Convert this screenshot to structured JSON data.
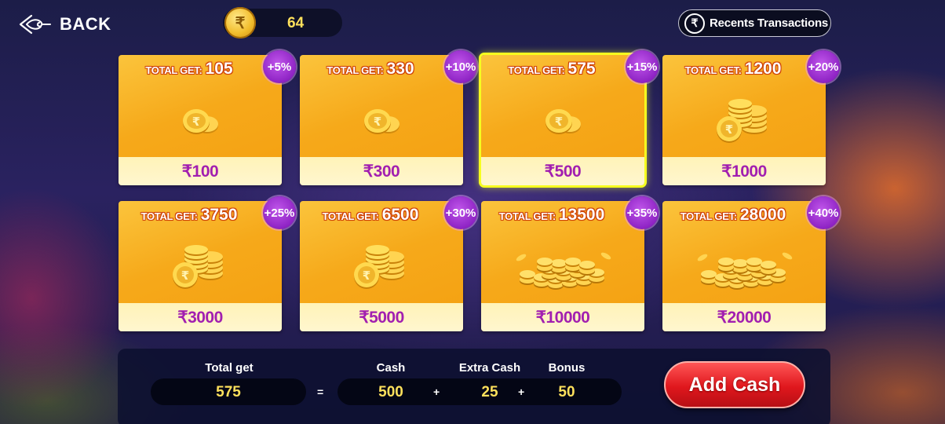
{
  "header": {
    "back_label": "BACK",
    "balance_currency_symbol": "₹",
    "balance_amount": "64",
    "recents_icon_symbol": "₹",
    "recents_label": "Recents Transactions"
  },
  "packages": [
    {
      "total_label": "TOTAL GET:",
      "total_value": "105",
      "bonus": "+5%",
      "price": "₹100",
      "coins_icon": "coin-single-icon"
    },
    {
      "total_label": "TOTAL GET:",
      "total_value": "330",
      "bonus": "+10%",
      "price": "₹300",
      "coins_icon": "coin-single-icon"
    },
    {
      "total_label": "TOTAL GET:",
      "total_value": "575",
      "bonus": "+15%",
      "price": "₹500",
      "coins_icon": "coin-single-icon",
      "selected": true
    },
    {
      "total_label": "TOTAL GET:",
      "total_value": "1200",
      "bonus": "+20%",
      "price": "₹1000",
      "coins_icon": "coin-stack-icon"
    },
    {
      "total_label": "TOTAL GET:",
      "total_value": "3750",
      "bonus": "+25%",
      "price": "₹3000",
      "coins_icon": "coin-stack-icon"
    },
    {
      "total_label": "TOTAL GET:",
      "total_value": "6500",
      "bonus": "+30%",
      "price": "₹5000",
      "coins_icon": "coin-stack-icon"
    },
    {
      "total_label": "TOTAL GET:",
      "total_value": "13500",
      "bonus": "+35%",
      "price": "₹10000",
      "coins_icon": "coin-pile-icon"
    },
    {
      "total_label": "TOTAL GET:",
      "total_value": "28000",
      "bonus": "+40%",
      "price": "₹20000",
      "coins_icon": "coin-pile-icon"
    }
  ],
  "summary": {
    "total_get_label": "Total get",
    "total_get_value": "575",
    "equals": "=",
    "cash_label": "Cash",
    "cash_value": "500",
    "plus1": "+",
    "extra_cash_label": "Extra Cash",
    "extra_cash_value": "25",
    "plus2": "+",
    "bonus_label": "Bonus",
    "bonus_value": "50"
  },
  "add_cash_label": "Add Cash",
  "colors": {
    "card_gold": "#f6a91a",
    "price_text": "#a21fb0",
    "badge_purple": "#8e23c4",
    "selected_outline": "#f6ff1f",
    "value_yellow": "#ffe15c",
    "add_cash_red": "#e0171d"
  }
}
